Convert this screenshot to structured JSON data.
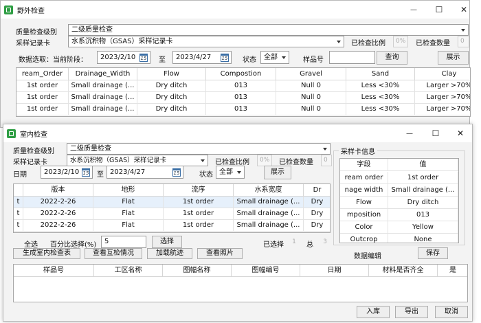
{
  "outer": {
    "title": "野外检查",
    "win_min": "—",
    "win_max": "☐",
    "win_close": "✕",
    "qc_level_label": "质量检查级别",
    "qc_level_value": "二级质量检查",
    "card_label": "采样记录卡",
    "card_value": "水系沉积物（GSAS）采样记录卡",
    "ratio_label": "已检查比例",
    "ratio_value": "0%",
    "count_label": "已检查数量",
    "count_value": "0",
    "range_label": "数据选取：当前阶段：",
    "date_from": "2023/2/10",
    "to_label": "至",
    "date_to": "2023/4/27",
    "status_label": "状态",
    "status_value": "全部",
    "sample_no_label": "样品号",
    "sample_no_value": "",
    "query_button": "查询",
    "show_button": "展示",
    "columns": [
      "ream_Order",
      "Drainage_Width",
      "Flow",
      "Compostion",
      "Gravel",
      "Sand",
      "Clay"
    ],
    "rows": [
      [
        "1st order",
        "Small drainage (...",
        "Dry ditch",
        "013",
        "Null 0",
        "Less <30%",
        "Larger >70%"
      ],
      [
        "1st order",
        "Small drainage (...",
        "Dry ditch",
        "013",
        "Null 0",
        "Less <30%",
        "Larger >70%"
      ],
      [
        "1st order",
        "Small drainage (...",
        "Dry ditch",
        "013",
        "Null 0",
        "Less <30%",
        "Larger >70%"
      ]
    ]
  },
  "inner": {
    "title": "室内检查",
    "win_min": "—",
    "win_max": "☐",
    "win_close": "✕",
    "qc_level_label": "质量检查级别",
    "qc_level_value": "二级质量检查",
    "card_label": "采样记录卡",
    "card_value": "水系沉积物（GSAS）采样记录卡",
    "ratio_label": "已检查比例",
    "ratio_value": "0%",
    "count_label": "已检查数量",
    "count_value": "0",
    "date_label": "日期",
    "date_from": "2023/2/10",
    "to_label": "至",
    "date_to": "2023/4/27",
    "status_label": "状态",
    "status_value": "全部",
    "show_button": "展示",
    "columns": [
      "",
      "版本",
      "地形",
      "流序",
      "水系宽度",
      "Dr"
    ],
    "rows": [
      [
        "t",
        "2022-2-26",
        "Flat",
        "1st order",
        "Small drainage (...",
        "Dry"
      ],
      [
        "t",
        "2022-2-26",
        "Flat",
        "1st order",
        "Small drainage (...",
        "Dry"
      ],
      [
        "t",
        "2022-2-26",
        "Flat",
        "1st order",
        "Small drainage (...",
        "Dry"
      ]
    ],
    "select_all": "全选",
    "percent_label": "百分比选择(%)",
    "percent_value": "5",
    "choose_button": "选择",
    "selected_label": "已选择",
    "selected_value": "1",
    "total_label": "总",
    "total_value": "3",
    "gen_table_button": "生成室内检查表",
    "mutual_check_button": "查看互检情况",
    "load_track_button": "加载航迹",
    "view_photo_button": "查看照片",
    "data_edit_label": "数据编辑",
    "save_button": "保存",
    "card_info_title": "采样卡信息",
    "card_info_headers": [
      "字段",
      "值"
    ],
    "card_info_rows": [
      [
        "ream order",
        "1st order"
      ],
      [
        "nage width",
        "Small drainage (..."
      ],
      [
        "Flow",
        "Dry ditch"
      ],
      [
        "mposition",
        "013"
      ],
      [
        "Color",
        "Yellow"
      ],
      [
        "Outcrop",
        "None"
      ]
    ],
    "bottom_columns": [
      "样品号",
      "工区名称",
      "图幅名称",
      "图幅编号",
      "日期",
      "材料是否齐全",
      "是"
    ],
    "import_button": "入库",
    "export_button": "导出",
    "cancel_button": "取消"
  }
}
